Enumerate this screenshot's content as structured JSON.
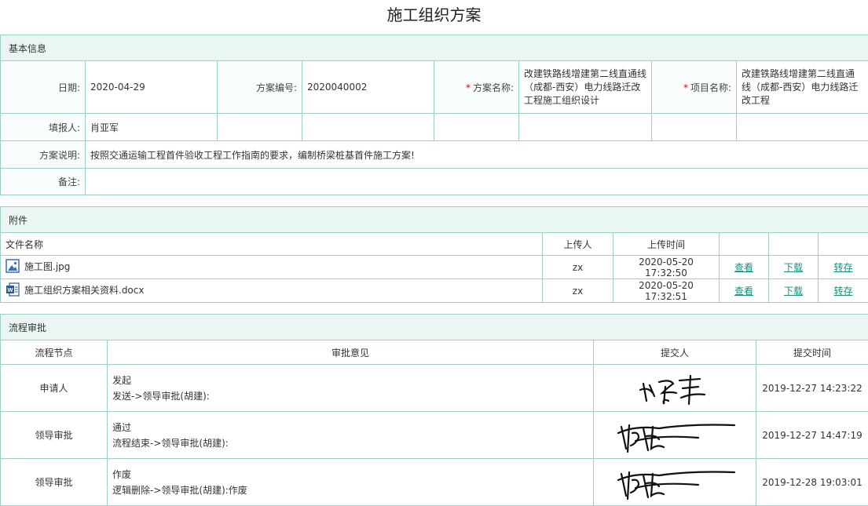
{
  "page": {
    "title": "施工组织方案"
  },
  "basic": {
    "section_title": "基本信息",
    "date_label": "日期:",
    "date_value": "2020-04-29",
    "plan_no_label": "方案编号:",
    "plan_no_value": "2020040002",
    "plan_name_label": "方案名称:",
    "plan_name_value": "改建铁路线增建第二线直通线（成都-西安）电力线路迁改工程施工组织设计",
    "project_name_label": "项目名称:",
    "project_name_value": "改建铁路线增建第二线直通线（成都-西安）电力线路迁改工程",
    "reporter_label": "填报人:",
    "reporter_value": "肖亚军",
    "desc_label": "方案说明:",
    "desc_value": "按照交通运输工程首件验收工程工作指南的要求，编制桥梁桩基首件施工方案!",
    "remark_label": "备注:",
    "remark_value": "",
    "required_mark": "*"
  },
  "attachments": {
    "section_title": "附件",
    "columns": {
      "file_name": "文件名称",
      "uploader": "上传人",
      "upload_time": "上传时间"
    },
    "files": [
      {
        "name": "施工图.jpg",
        "icon": "image-icon",
        "uploader": "zx",
        "time": "2020-05-20 17:32:50",
        "view": "查看",
        "download": "下载",
        "save": "转存"
      },
      {
        "name": "施工组织方案相关资料.docx",
        "icon": "word-doc-icon",
        "uploader": "zx",
        "time": "2020-05-20 17:32:51",
        "view": "查看",
        "download": "下载",
        "save": "转存"
      }
    ],
    "colors": {
      "link": "#17907e",
      "border": "#9ecfc7",
      "header_bg": "#eaf6f4"
    }
  },
  "flow": {
    "section_title": "流程审批",
    "columns": {
      "node": "流程节点",
      "opinion": "审批意见",
      "submitter": "提交人",
      "time": "提交时间"
    },
    "rows": [
      {
        "node": "申请人",
        "opinion_title": "发起",
        "opinion_detail": "发送->领导审批(胡建):",
        "time": "2019-12-27 14:23:22"
      },
      {
        "node": "领导审批",
        "opinion_title": "通过",
        "opinion_detail": "流程结束->领导审批(胡建):",
        "time": "2019-12-27 14:47:19"
      },
      {
        "node": "领导审批",
        "opinion_title": "作废",
        "opinion_detail": "逻辑删除->领导审批(胡建):作废",
        "time": "2019-12-28 19:03:01"
      }
    ]
  }
}
